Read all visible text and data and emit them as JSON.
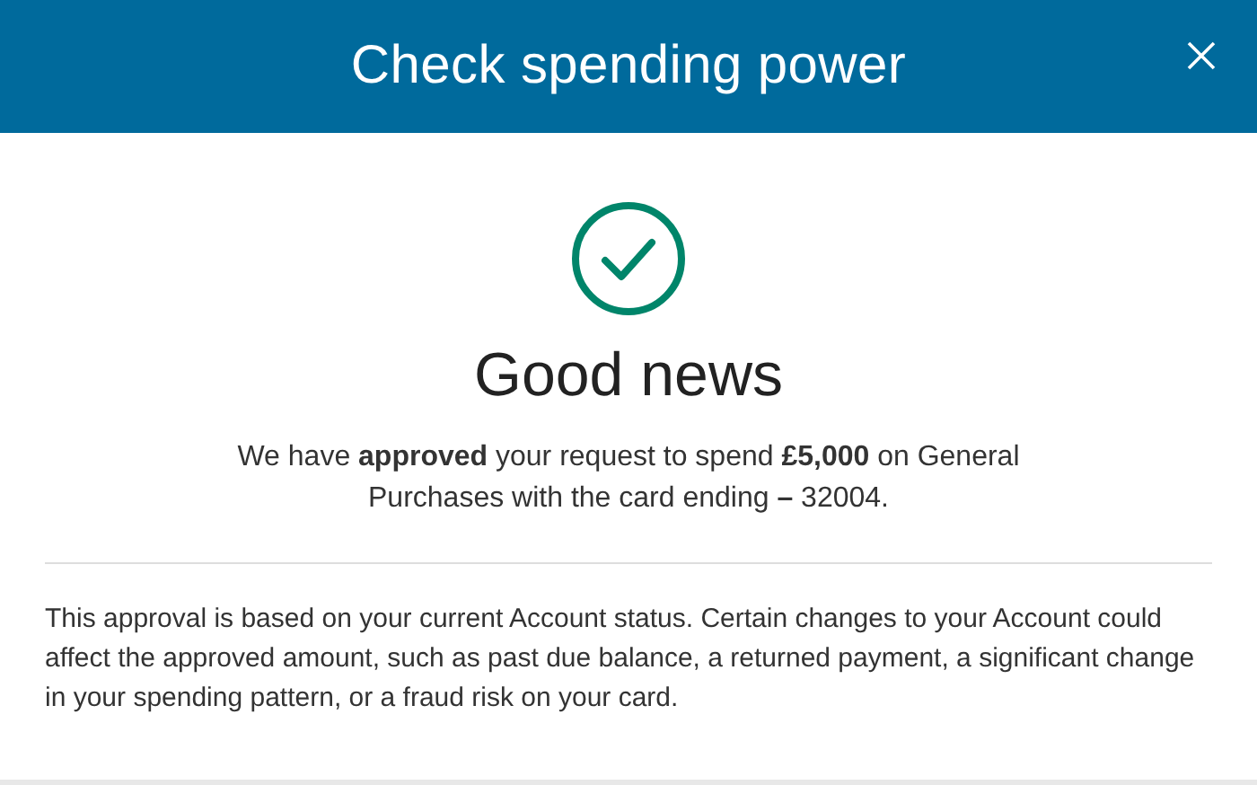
{
  "dialog": {
    "title": "Check spending power"
  },
  "result": {
    "approved": true,
    "heading": "Good news",
    "message": "We have **approved** your request to spend **£5,000** on General Purchases with the card ending **–** 32004."
  },
  "disclaimer": "This approval is based on your current Account status. Certain changes to your Account could affect the approved amount, such as past due balance, a returned payment, a significant change in your spending pattern, or a fraud risk on your card."
}
